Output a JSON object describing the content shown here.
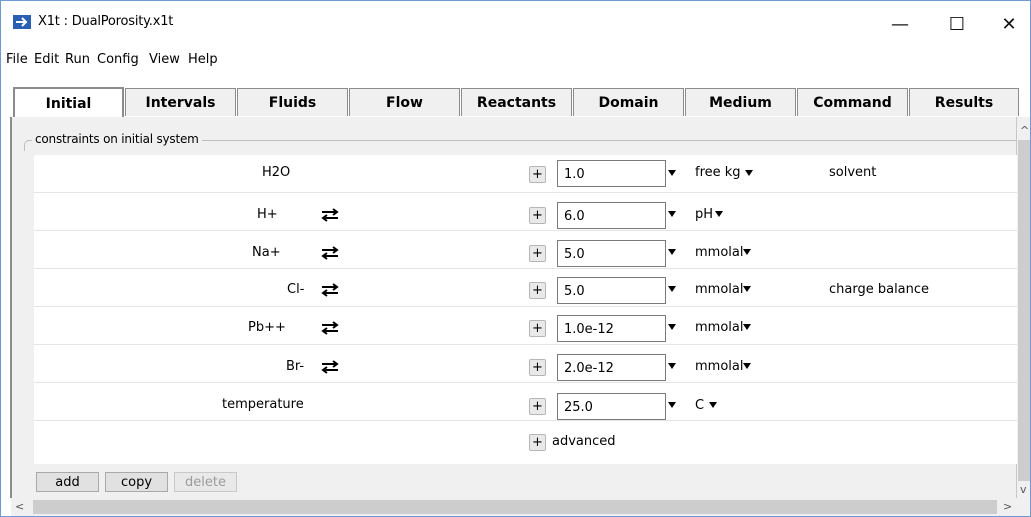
{
  "window": {
    "title": "X1t : DualPorosity.x1t",
    "minimize": "—",
    "maximize": "☐",
    "close": "✕"
  },
  "menu": [
    "File",
    "Edit",
    "Run",
    "Config",
    "View",
    "Help"
  ],
  "tabs": [
    "Initial",
    "Intervals",
    "Fluids",
    "Flow",
    "Reactants",
    "Domain",
    "Medium",
    "Command",
    "Results"
  ],
  "active_tab": "Initial",
  "group_title": "constraints on initial system",
  "rows": [
    {
      "species": "H2O",
      "swap": false,
      "value": "1.0",
      "unit": "free kg",
      "note": "solvent"
    },
    {
      "species": "H+",
      "swap": true,
      "value": "6.0",
      "unit": "pH",
      "note": ""
    },
    {
      "species": "Na+",
      "swap": true,
      "value": "5.0",
      "unit": "mmolal",
      "note": ""
    },
    {
      "species": "Cl-",
      "swap": true,
      "value": "5.0",
      "unit": "mmolal",
      "note": "charge balance"
    },
    {
      "species": "Pb++",
      "swap": true,
      "value": "1.0e-12",
      "unit": "mmolal",
      "note": ""
    },
    {
      "species": "Br-",
      "swap": true,
      "value": "2.0e-12",
      "unit": "mmolal",
      "note": ""
    },
    {
      "species": "temperature",
      "swap": false,
      "value": "25.0",
      "unit": "C",
      "note": ""
    }
  ],
  "advanced": "advanced",
  "plus_label": "+",
  "buttons": {
    "add": "add",
    "copy": "copy",
    "delete": "delete"
  },
  "scroll": {
    "up": "^",
    "down": "v",
    "left": "<",
    "right": ">"
  },
  "colors": {
    "accent": "#2b5fb4",
    "window_border": "#6f9bd1",
    "panel_bg": "#f0f0f0"
  }
}
